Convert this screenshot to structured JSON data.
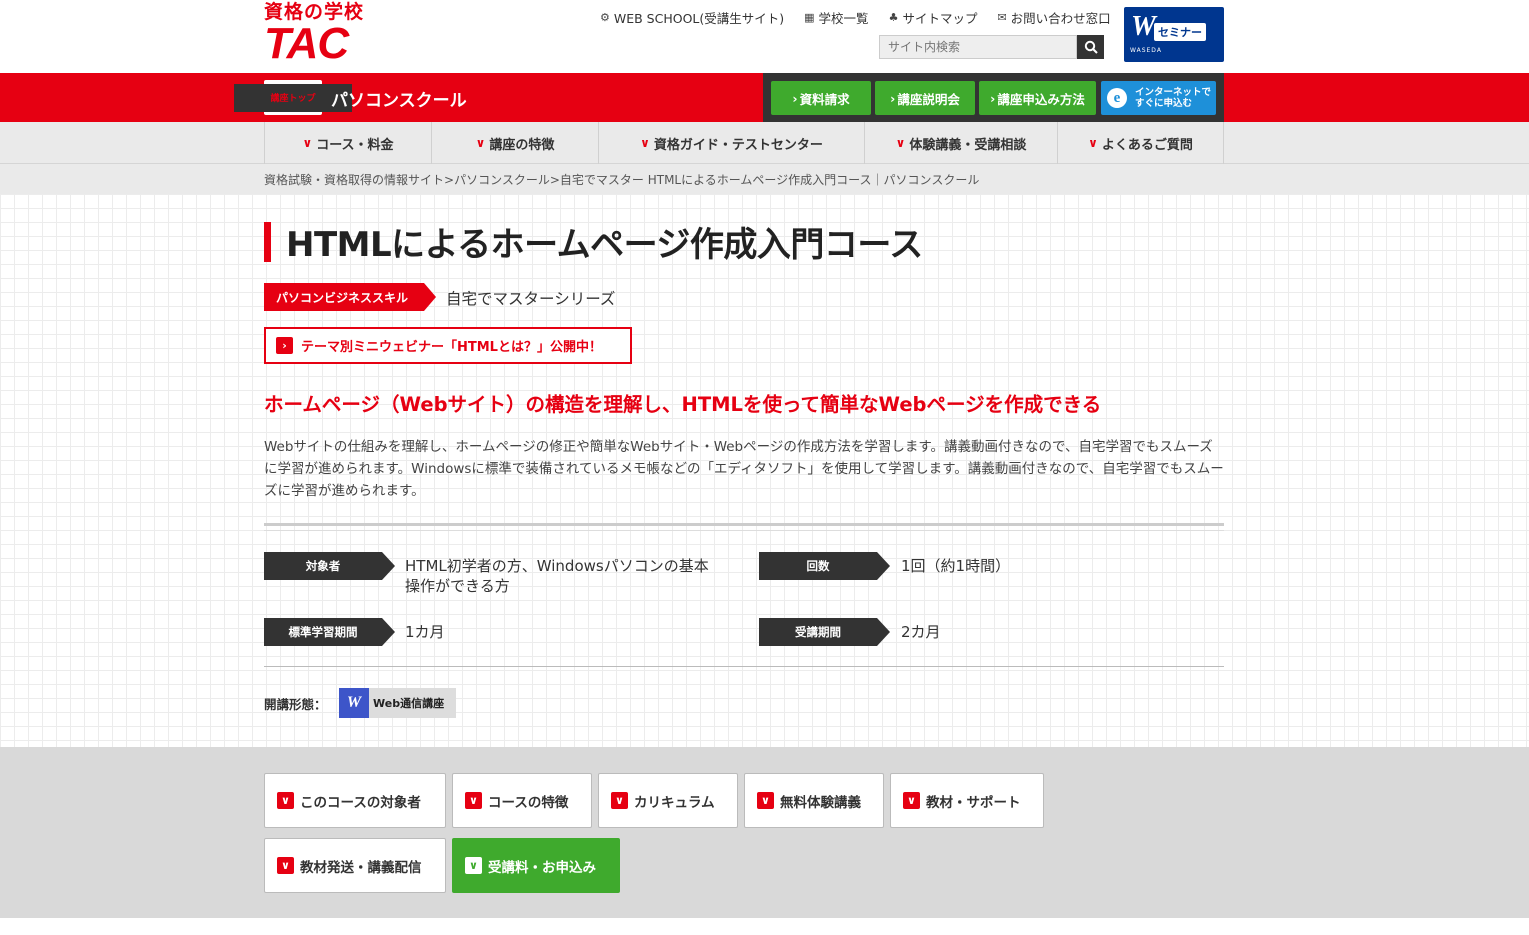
{
  "header": {
    "logo_top": "資格の学校",
    "logo_main": "TAC",
    "util_links": [
      {
        "icon": "gear-icon",
        "glyph": "⚙",
        "label": "WEB SCHOOL(受講生サイト)"
      },
      {
        "icon": "school-list-icon",
        "glyph": "▦",
        "label": "学校一覧"
      },
      {
        "icon": "sitemap-icon",
        "glyph": "♣",
        "label": "サイトマップ"
      },
      {
        "icon": "mail-icon",
        "glyph": "✉",
        "label": "お問い合わせ窓口"
      }
    ],
    "search_placeholder": "サイト内検索",
    "waseda_w": "W",
    "waseda_label": "セミナー",
    "waseda_sub": "WASEDA"
  },
  "redbar": {
    "home_icon_label": "講座トップ",
    "school_name": "パソコンスクール",
    "cta": [
      {
        "label": "資料請求"
      },
      {
        "label": "講座説明会"
      },
      {
        "label": "講座申込み方法"
      }
    ],
    "internet_line1": "インターネットで",
    "internet_line2": "すぐに申込む"
  },
  "gnav": [
    {
      "label": "コース・料金"
    },
    {
      "label": "講座の特徴"
    },
    {
      "label": "資格ガイド・テストセンター"
    },
    {
      "label": "体験講義・受講相談"
    },
    {
      "label": "よくあるご質問"
    }
  ],
  "breadcrumb": {
    "link1": "資格試験・資格取得の情報サイト",
    "sep": ">",
    "link2": "パソコンスクール",
    "current": "自宅でマスター HTMLによるホームページ作成入門コース｜パソコンスクール"
  },
  "main": {
    "title": "HTMLによるホームページ作成入門コース",
    "category_tag": "パソコンビジネススキル",
    "series": "自宅でマスターシリーズ",
    "webinar_link": "テーマ別ミニウェビナー「HTMLとは？」公開中！",
    "lead": "ホームページ（Webサイト）の構造を理解し、HTMLを使って簡単なWebページを作成できる",
    "description": "Webサイトの仕組みを理解し、ホームページの修正や簡単なWebサイト・Webページの作成方法を学習します。講義動画付きなので、自宅学習でもスムーズに学習が進められます。Windowsに標準で装備されているメモ帳などの「エディタソフト」を使用して学習します。講義動画付きなので、自宅学習でもスムーズに学習が進められます。",
    "info": [
      {
        "label": "対象者",
        "value_line1": "HTML初学者の方、Windowsパソコンの基本",
        "value_line2": "操作ができる方"
      },
      {
        "label": "回数",
        "value": "1回（約1時間）"
      },
      {
        "label": "標準学習期間",
        "value": "1カ月"
      },
      {
        "label": "受講期間",
        "value": "2カ月"
      }
    ],
    "format_label": "開講形態：",
    "format_badge": "Web通信講座"
  },
  "bottom_nav": [
    {
      "label": "このコースの対象者"
    },
    {
      "label": "コースの特徴"
    },
    {
      "label": "カリキュラム"
    },
    {
      "label": "無料体験講義"
    },
    {
      "label": "教材・サポート"
    },
    {
      "label": "教材発送・講義配信"
    },
    {
      "label": "受講料・お申込み"
    }
  ],
  "colors": {
    "brand_red": "#e60012",
    "cta_green": "#3faa2d",
    "cta_blue": "#1e90d9",
    "waseda_blue": "#00368f"
  }
}
